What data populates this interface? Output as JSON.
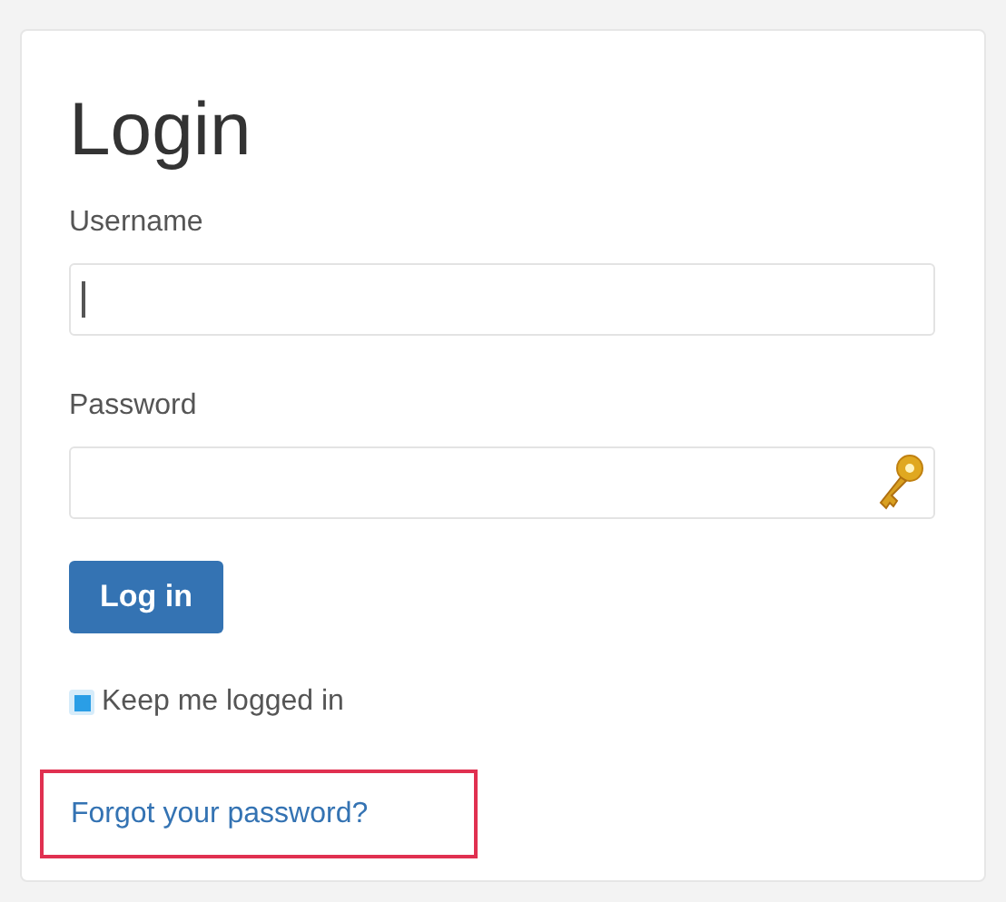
{
  "title": "Login",
  "username": {
    "label": "Username",
    "focused": true
  },
  "password": {
    "label": "Password"
  },
  "login_button": {
    "label": "Log in"
  },
  "keep_logged_in": {
    "label": "Keep me logged in",
    "checked": true
  },
  "forgot_link": {
    "label": "Forgot your password?",
    "highlighted": true
  }
}
